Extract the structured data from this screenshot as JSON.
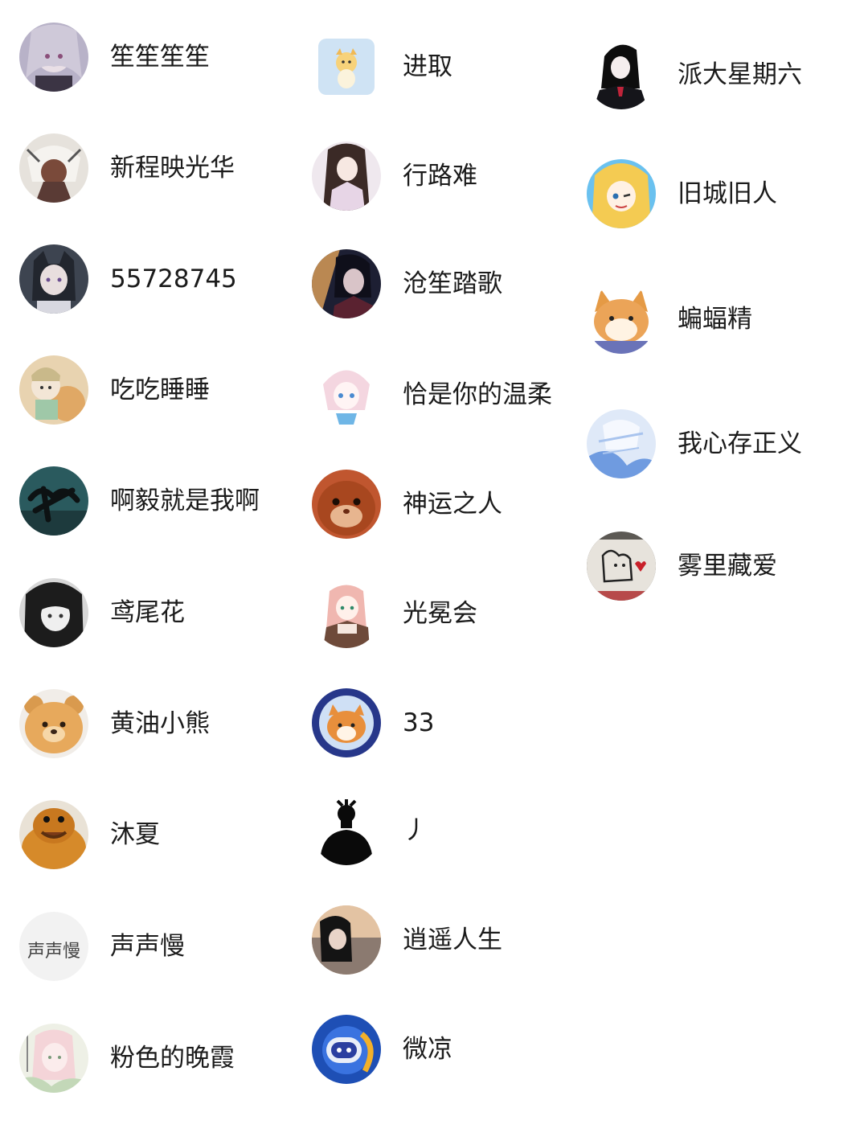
{
  "columns": [
    {
      "items": [
        {
          "name": "笙笙笙笙",
          "avatar": "anime-girl-silver-hair-avatar"
        },
        {
          "name": "新程映光华",
          "avatar": "anime-character-white-hair-avatar"
        },
        {
          "name": "55728745",
          "avatar": "anime-girl-dark-hair-avatar"
        },
        {
          "name": "吃吃睡睡",
          "avatar": "anime-chibi-avatar"
        },
        {
          "name": "啊毅就是我啊",
          "avatar": "calligraphy-art-avatar"
        },
        {
          "name": "鸢尾花",
          "avatar": "monochrome-anime-girl-avatar"
        },
        {
          "name": "黄油小熊",
          "avatar": "butter-bear-avatar"
        },
        {
          "name": "沐夏",
          "avatar": "cartoon-bear-avatar"
        },
        {
          "name": "声声慢",
          "avatar": "calligraphy-text-avatar",
          "avatar_text": "声声慢"
        },
        {
          "name": "粉色的晚霞",
          "avatar": "pastel-anime-girl-avatar"
        }
      ]
    },
    {
      "items": [
        {
          "name": "进取",
          "avatar": "cartoon-animal-square-avatar"
        },
        {
          "name": "行路难",
          "avatar": "ancient-style-girl-avatar"
        },
        {
          "name": "沧笙踏歌",
          "avatar": "dark-anime-boy-avatar"
        },
        {
          "name": "恰是你的温柔",
          "avatar": "pink-hair-anime-girl-avatar"
        },
        {
          "name": "神运之人",
          "avatar": "hamster-avatar"
        },
        {
          "name": "光冕会",
          "avatar": "anime-maid-girl-avatar"
        },
        {
          "name": "33",
          "avatar": "shiba-astronaut-avatar"
        },
        {
          "name": "丿",
          "avatar": "silhouette-person-avatar"
        },
        {
          "name": "逍遥人生",
          "avatar": "sunset-portrait-avatar"
        },
        {
          "name": "微凉",
          "avatar": "blue-robot-avatar"
        }
      ]
    },
    {
      "items": [
        {
          "name": "派大星期六",
          "avatar": "black-hair-girl-avatar"
        },
        {
          "name": "旧城旧人",
          "avatar": "blonde-anime-girl-avatar"
        },
        {
          "name": "蝙蝠精",
          "avatar": "shiba-dog-avatar"
        },
        {
          "name": "我心存正义",
          "avatar": "blue-sketch-avatar"
        },
        {
          "name": "雾里藏爱",
          "avatar": "cinnamoroll-drawing-avatar"
        }
      ]
    }
  ]
}
